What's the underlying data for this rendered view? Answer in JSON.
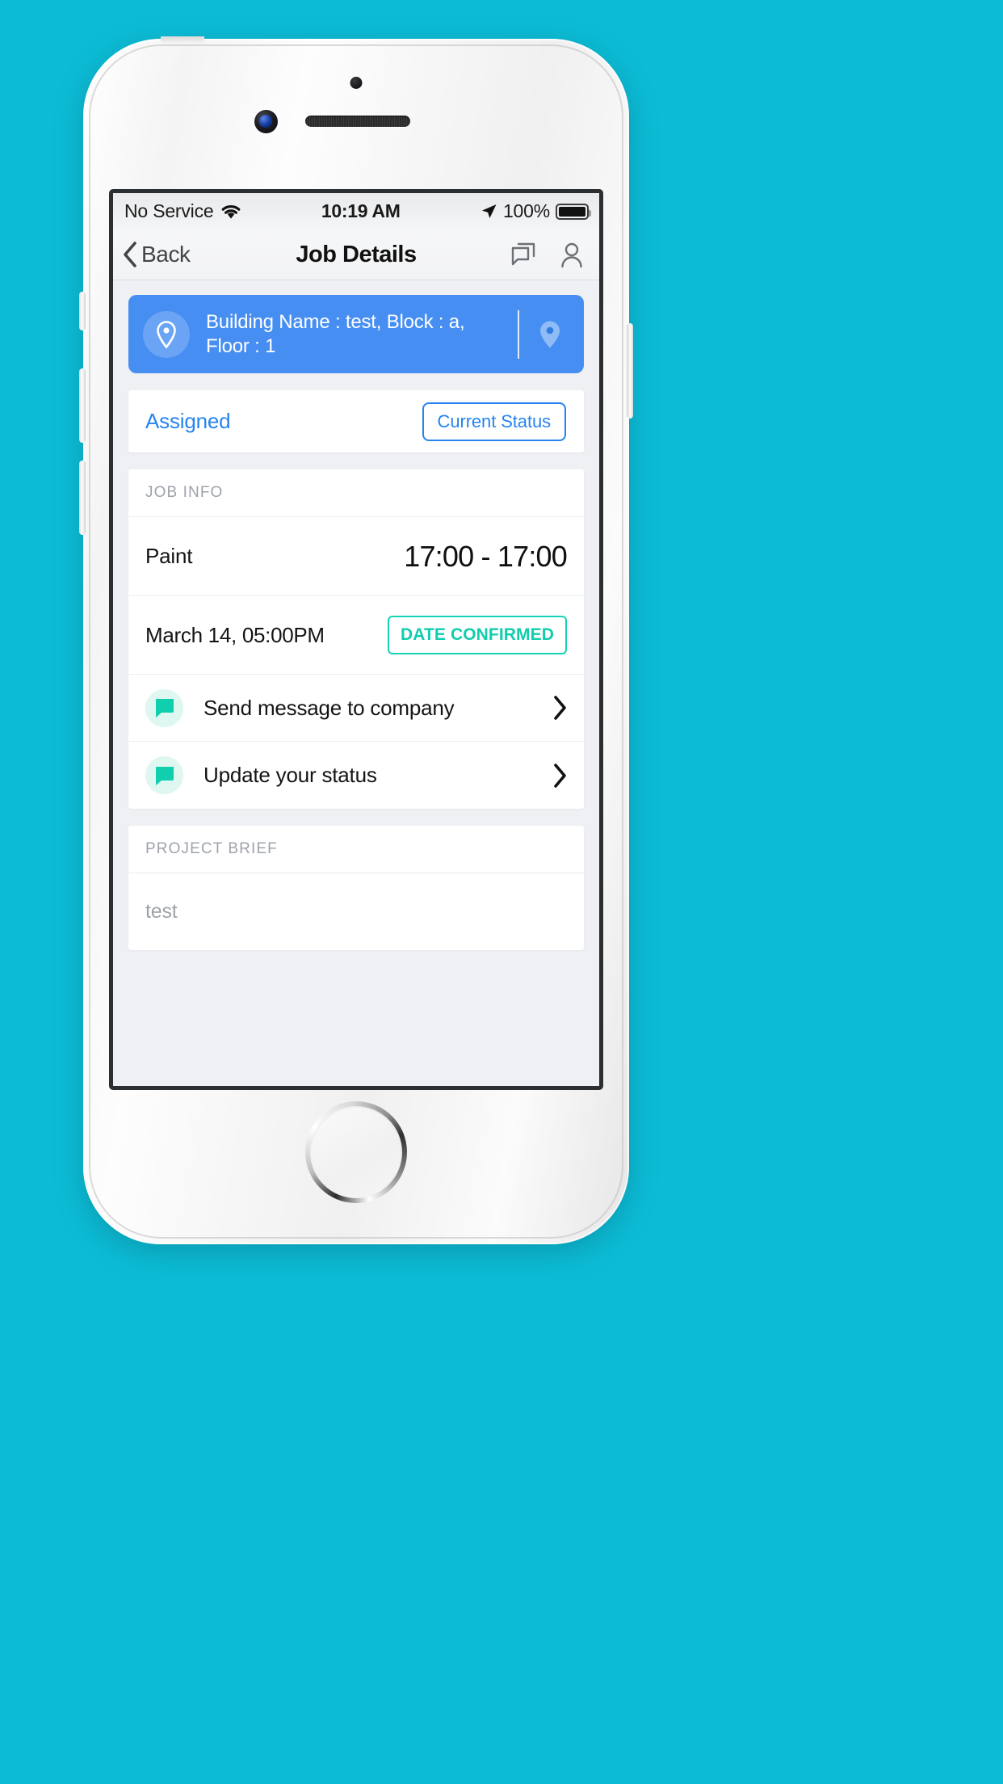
{
  "theme": {
    "background": "#0cbcd6",
    "accent_blue": "#468ef2",
    "link_blue": "#2684f0",
    "accent_teal": "#11cdae",
    "icon_bg_teal": "#dff7f1",
    "muted": "#9ea3ab"
  },
  "status_bar": {
    "carrier": "No Service",
    "wifi_icon": "wifi-icon",
    "time": "10:19 AM",
    "location_icon": "location-arrow-icon",
    "battery_percent": "100%",
    "battery_icon": "battery-full-icon"
  },
  "nav_bar": {
    "back_icon": "chevron-left-icon",
    "back_label": "Back",
    "title": "Job Details",
    "actions": [
      {
        "name": "messages-icon",
        "label": "Messages"
      },
      {
        "name": "profile-icon",
        "label": "Profile"
      }
    ]
  },
  "location_banner": {
    "pin_icon": "location-pin-icon",
    "text": "Building Name : test, Block : a, Floor : 1",
    "map_icon": "map-pin-icon"
  },
  "status_card": {
    "status": "Assigned",
    "button_label": "Current Status"
  },
  "job_info": {
    "header": "JOB INFO",
    "job_name": "Paint",
    "job_time": "17:00 - 17:00",
    "date": "March 14, 05:00PM",
    "date_badge": "DATE CONFIRMED",
    "actions": [
      {
        "icon": "chat-bubble-icon",
        "label": "Send message to company",
        "chevron": "chevron-right-icon"
      },
      {
        "icon": "chat-bubble-icon",
        "label": "Update your status",
        "chevron": "chevron-right-icon"
      }
    ]
  },
  "project_brief": {
    "header": "PROJECT BRIEF",
    "body": "test"
  }
}
